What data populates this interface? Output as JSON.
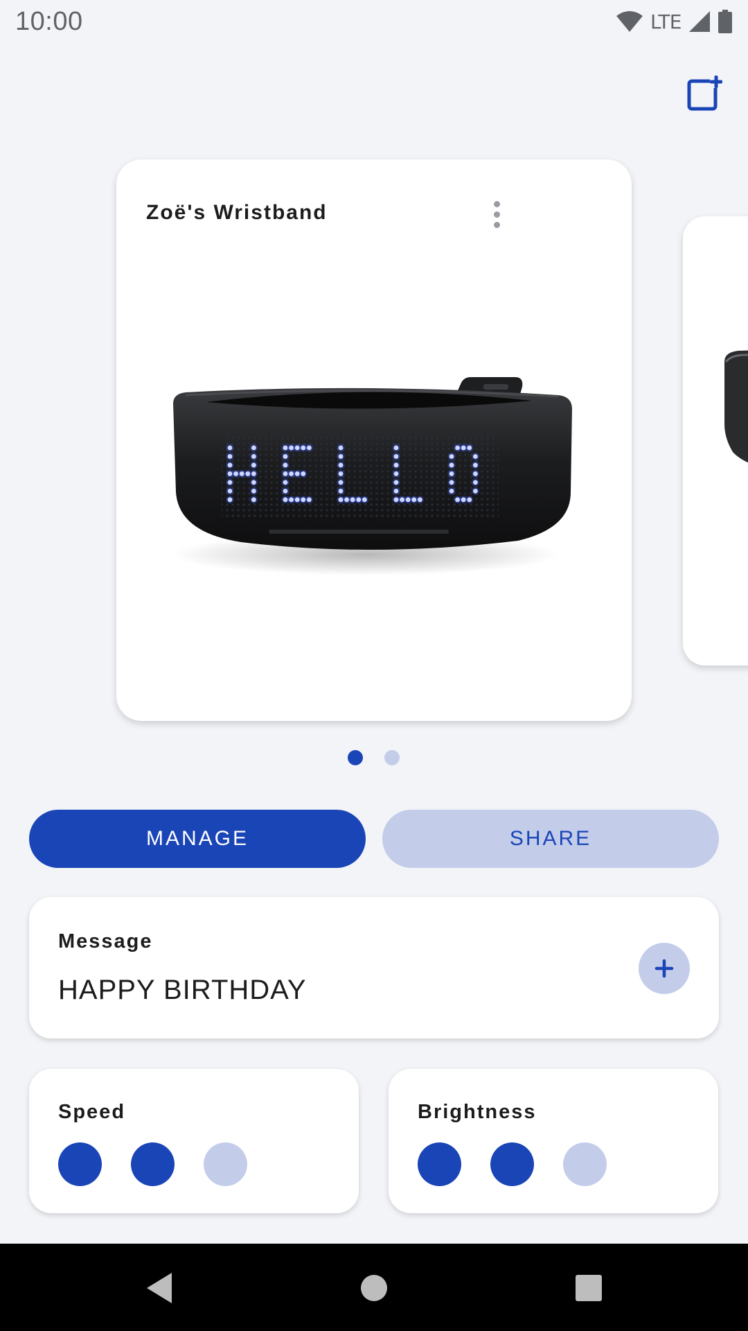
{
  "status_bar": {
    "time": "10:00",
    "network": "LTE"
  },
  "header": {
    "add_device_icon": "add-device-icon"
  },
  "device_card": {
    "title": "Zoë's Wristband",
    "display_text": "HELLO",
    "menu_icon": "more-vertical-icon"
  },
  "pager": {
    "total": 2,
    "active": 1
  },
  "actions": {
    "manage_label": "MANAGE",
    "share_label": "SHARE"
  },
  "message": {
    "label": "Message",
    "value": "HAPPY BIRTHDAY",
    "add_icon": "plus-icon"
  },
  "speed": {
    "label": "Speed",
    "level": 2,
    "max": 3
  },
  "brightness": {
    "label": "Brightness",
    "level": 2,
    "max": 3
  },
  "colors": {
    "primary": "#1a45b7",
    "primary_light": "#c3cdea",
    "background": "#f3f4f8",
    "led": "#3a5cff"
  }
}
